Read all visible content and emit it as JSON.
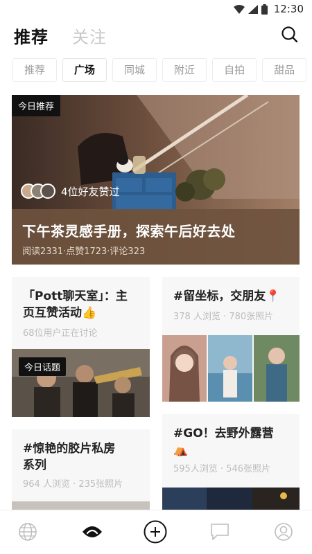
{
  "status_bar": {
    "time": "12:30"
  },
  "header": {
    "tabs": [
      {
        "label": "推荐",
        "active": true
      },
      {
        "label": "关注",
        "active": false
      }
    ]
  },
  "categories": [
    {
      "label": "推荐",
      "active": false
    },
    {
      "label": "广场",
      "active": true
    },
    {
      "label": "同城",
      "active": false
    },
    {
      "label": "附近",
      "active": false
    },
    {
      "label": "自拍",
      "active": false
    },
    {
      "label": "甜品",
      "active": false
    }
  ],
  "hero": {
    "tag": "今日推荐",
    "friends_liked": "4位好友赞过",
    "title": "下午茶灵感手册，探索午后好去处",
    "meta": "阅读2331·点赞1723·评论323"
  },
  "cards": {
    "left_1": {
      "title_line1": "「Pott聊天室」：主",
      "title_line2": "页互赞活动👍",
      "meta": "68位用户正在讨论",
      "tag": "今日话题"
    },
    "left_2": {
      "title_line1": "#惊艳的胶片私房",
      "title_line2": "系列",
      "meta": "964 人浏览 · 235张照片"
    },
    "right_1": {
      "title_line1": "#留坐标，交朋友📍",
      "meta": "378 人浏览 · 780张照片"
    },
    "right_2": {
      "title_line1": "#GO！去野外露营",
      "title_line2": "⛺",
      "meta": "595人浏览 · 546张照片"
    }
  },
  "bottom_nav": [
    {
      "icon": "globe-icon",
      "active": false
    },
    {
      "icon": "eye-icon",
      "active": true
    },
    {
      "icon": "plus-circle-icon",
      "active": false
    },
    {
      "icon": "chat-icon",
      "active": false
    },
    {
      "icon": "profile-icon",
      "active": false
    }
  ]
}
